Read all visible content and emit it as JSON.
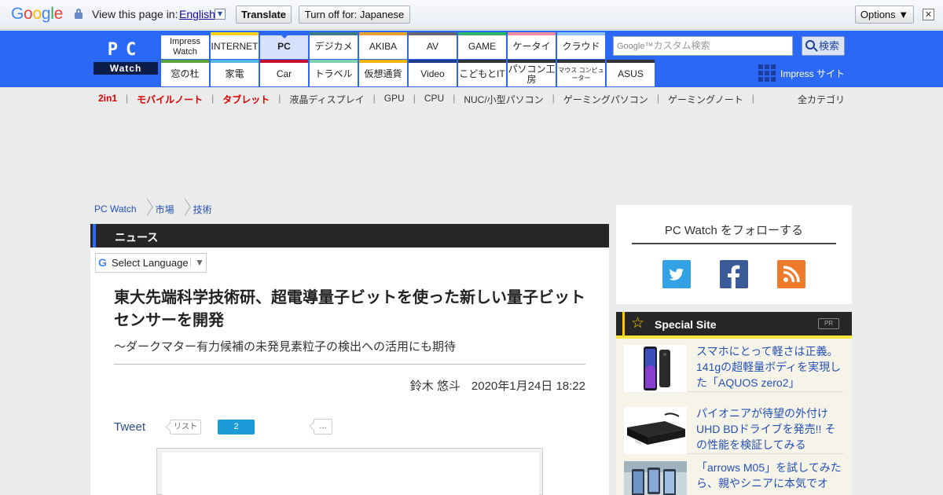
{
  "translate_bar": {
    "logo": "Google",
    "prompt": "View this page in:",
    "language": "English",
    "translate_label": "Translate",
    "turn_off_label": "Turn off for: Japanese",
    "options_label": "Options ▼",
    "close_label": "✕"
  },
  "header": {
    "logo_pc": "PC",
    "logo_watch": "Watch",
    "nav_top": [
      {
        "label": "Impress Watch",
        "color": "#2b68f5"
      },
      {
        "label": "INTERNET",
        "color": "#f6d21b"
      },
      {
        "label": "PC",
        "color": "#2b68f5"
      },
      {
        "label": "デジカメ",
        "color": "#3b7b86"
      },
      {
        "label": "AKIBA",
        "color": "#e7a136"
      },
      {
        "label": "AV",
        "color": "#65686e"
      },
      {
        "label": "GAME",
        "color": "#2db36b"
      },
      {
        "label": "ケータイ",
        "color": "#eb8ea0"
      },
      {
        "label": "クラウド",
        "color": "#8ac5ef"
      }
    ],
    "nav_bottom": [
      {
        "label": "窓の杜",
        "color": "#5aa33c"
      },
      {
        "label": "家電",
        "color": "#5ab6e6"
      },
      {
        "label": "Car",
        "color": "#c8102e"
      },
      {
        "label": "トラベル",
        "color": "#7ed0b1"
      },
      {
        "label": "仮想通貨",
        "color": "#f0b400"
      },
      {
        "label": "Video",
        "color": "#1d3d8c"
      },
      {
        "label": "こどもとIT",
        "color": "#333333"
      },
      {
        "label": "パソコン工房",
        "color": "#333333"
      },
      {
        "label": "マウス コンピューター",
        "color": "#333333"
      },
      {
        "label": "ASUS",
        "color": "#333333"
      }
    ],
    "search_google": "Google™",
    "search_placeholder": "カスタム検索",
    "search_button": "検索",
    "impress_site": "Impress サイト"
  },
  "subnav": {
    "items": [
      {
        "label": "2in1",
        "red": true
      },
      {
        "label": "モバイルノート",
        "red": true
      },
      {
        "label": "タブレット",
        "red": true
      },
      {
        "label": "液晶ディスプレイ",
        "red": false
      },
      {
        "label": "GPU",
        "red": false
      },
      {
        "label": "CPU",
        "red": false
      },
      {
        "label": "NUC/小型パソコン",
        "red": false
      },
      {
        "label": "ゲーミングパソコン",
        "red": false
      },
      {
        "label": "ゲーミングノート",
        "red": false
      }
    ],
    "all_categories": "全カテゴリ"
  },
  "breadcrumb": [
    "PC Watch",
    "市場",
    "技術"
  ],
  "article": {
    "section": "ニュース",
    "select_language": "Select Language",
    "title": "東大先端科学技術研、超電導量子ビットを使った新しい量子ビットセンサーを開発",
    "subtitle": "～ダークマター有力候補の未発見素粒子の検出への活用にも期待",
    "author": "鈴木 悠斗",
    "date": "2020年1月24日 18:22",
    "tweet": "Tweet",
    "list_label": "リスト",
    "share_count": "2",
    "more_label": "..."
  },
  "sidebar": {
    "follow_title": "PC Watch をフォローする",
    "special_title": "Special Site",
    "pr_label": "PR",
    "special_items": [
      {
        "text": "スマホにとって軽さは正義。141gの超軽量ボディを実現した「AQUOS zero2」"
      },
      {
        "text": "パイオニアが待望の外付けUHD BDドライブを発売!! その性能を検証してみる"
      },
      {
        "text": "「arrows M05」を試してみたら、親やシニアに本気でオ"
      }
    ]
  }
}
